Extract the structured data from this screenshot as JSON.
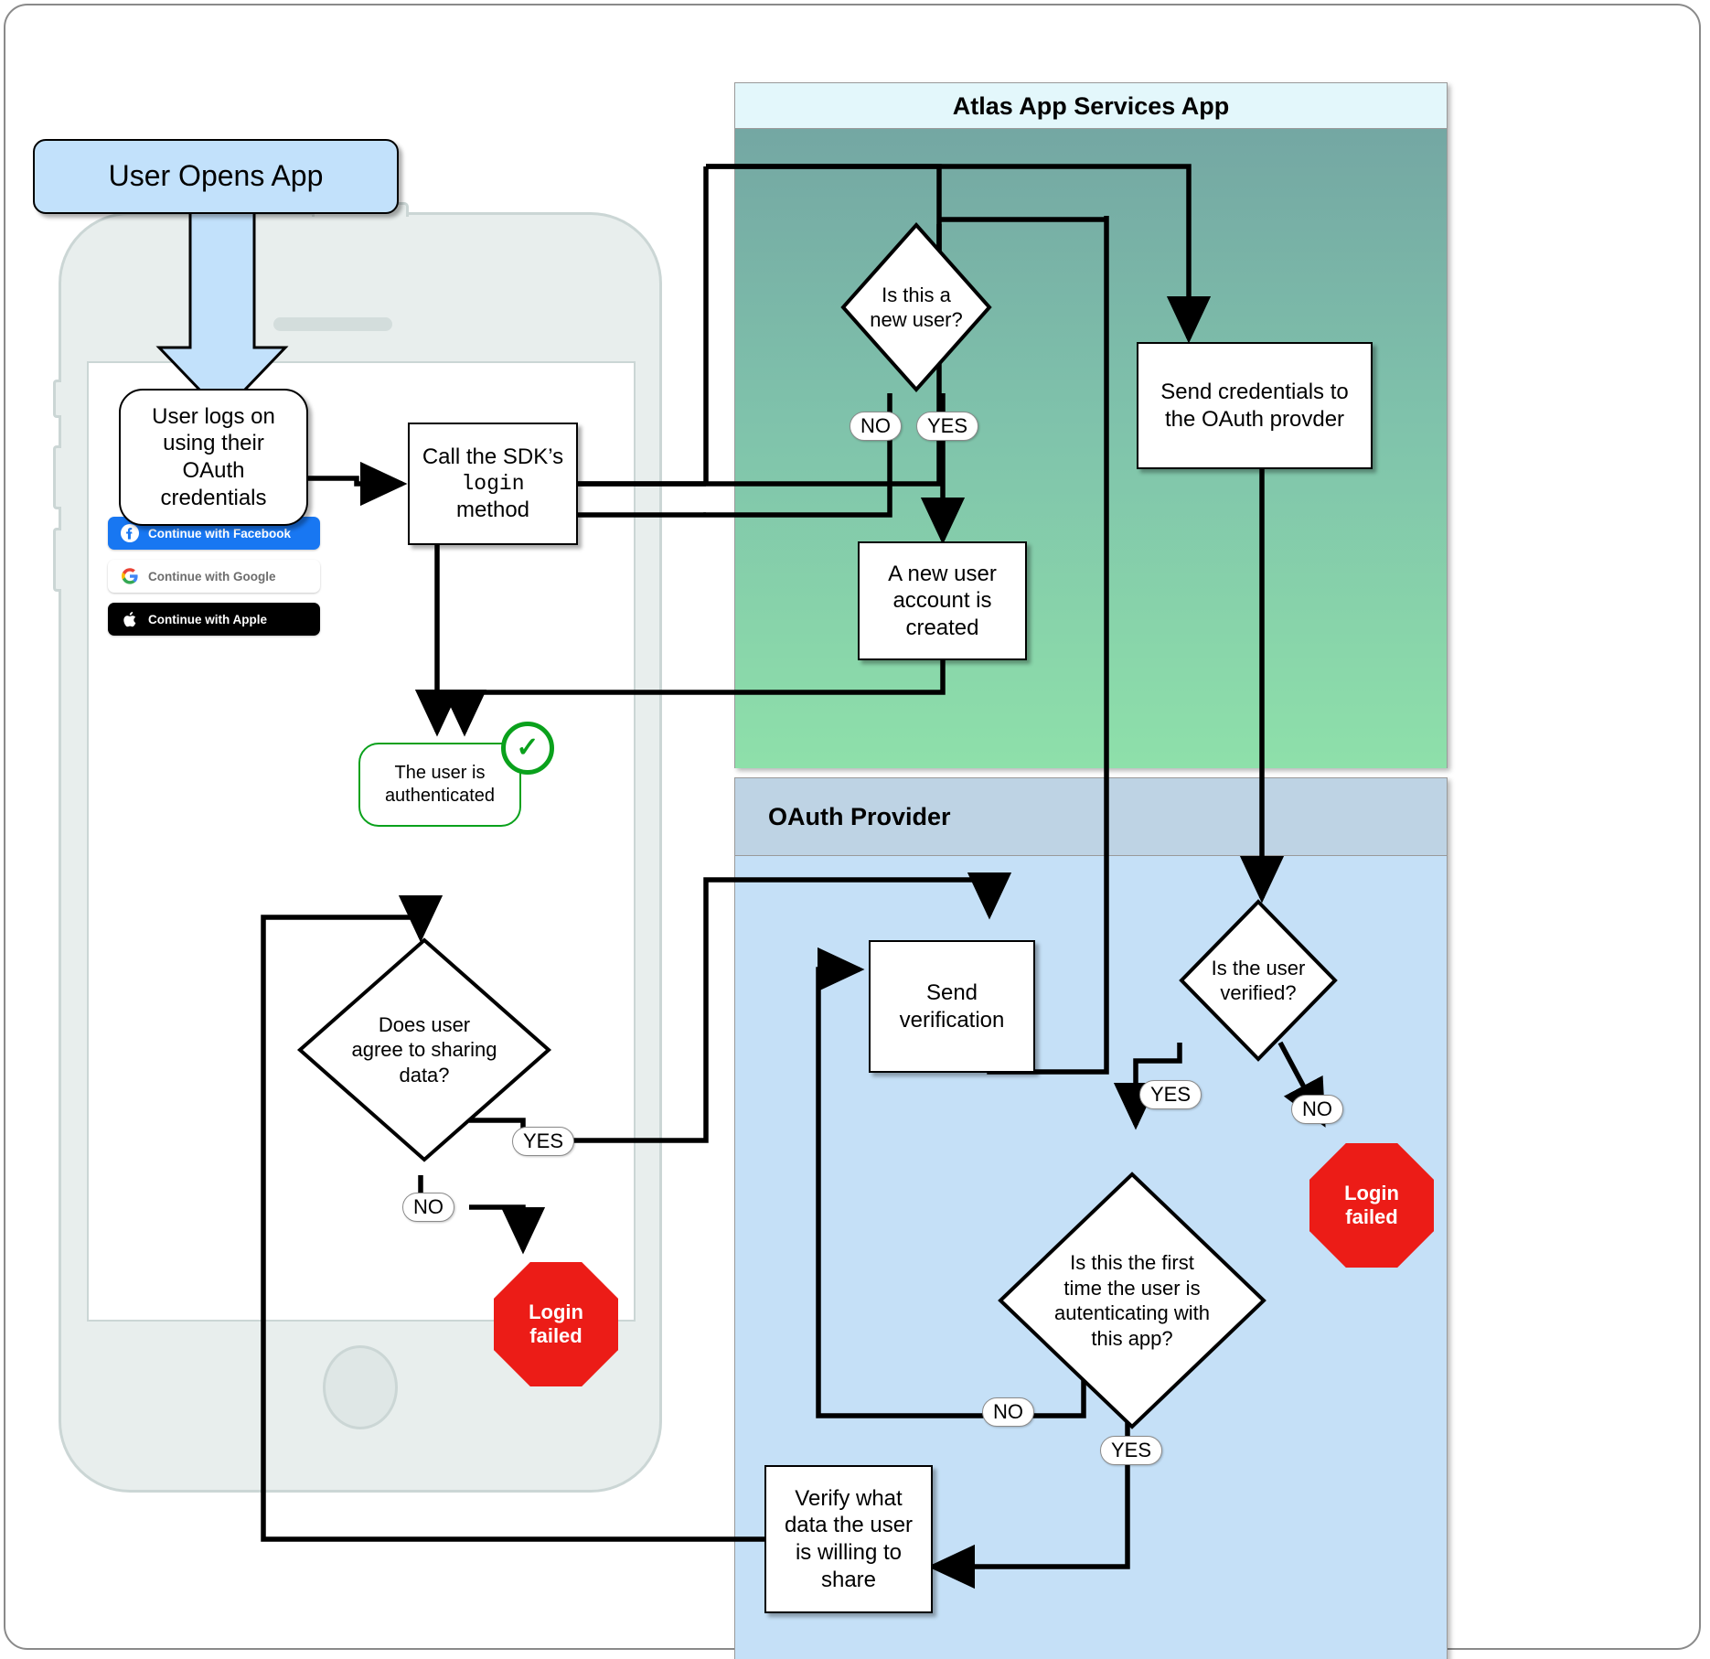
{
  "diagram": {
    "title": "OAuth authentication flow",
    "colors": {
      "start_fill": "#c2e1fb",
      "atlas_header": "#e3f7fb",
      "atlas_body_top": "#74a7a3",
      "atlas_body_bottom": "#8ee0aa",
      "oauth_header": "#bed3e4",
      "oauth_body": "#c5e0f7",
      "stop_fill": "#ec1c17",
      "success_stroke": "#0aa11c",
      "phone_body": "#e8eeed"
    }
  },
  "start": {
    "label": "User Opens App"
  },
  "phone": {
    "login_node": "User logs on\nusing their\nOAuth\ncredentials",
    "buttons": [
      {
        "label": "Continue with Facebook",
        "icon": "facebook-icon",
        "style": "facebook"
      },
      {
        "label": "Continue with Google",
        "icon": "google-icon",
        "style": "google"
      },
      {
        "label": "Continue with Apple",
        "icon": "apple-icon",
        "style": "apple"
      }
    ],
    "sdk_node": {
      "line1": "Call the SDK’s",
      "code": "login",
      "line3": "method"
    },
    "authenticated": {
      "label": "The user is\nauthenticated",
      "badge": "check-icon"
    },
    "agree_decision": "Does user\nagree to sharing\ndata?",
    "agree_yes": "YES",
    "agree_no": "NO",
    "login_failed": "Login\nfailed"
  },
  "atlas_lane": {
    "header": "Atlas App Services App",
    "new_user_decision": "Is this a\nnew user?",
    "new_user_no": "NO",
    "new_user_yes": "YES",
    "new_account": "A new user\naccount is\ncreated",
    "send_credentials": "Send credentials to\nthe OAuth provder"
  },
  "oauth_lane": {
    "header": "OAuth Provider",
    "send_verification": "Send\nverification",
    "is_verified_decision": "Is the user\nverified?",
    "verified_yes": "YES",
    "verified_no": "NO",
    "login_failed": "Login\nfailed",
    "first_time_decision": "Is this the first\ntime the user is\nautenticating with\nthis app?",
    "first_time_no": "NO",
    "first_time_yes": "YES",
    "verify_data": "Verify what\ndata the user\nis willing to\nshare"
  }
}
